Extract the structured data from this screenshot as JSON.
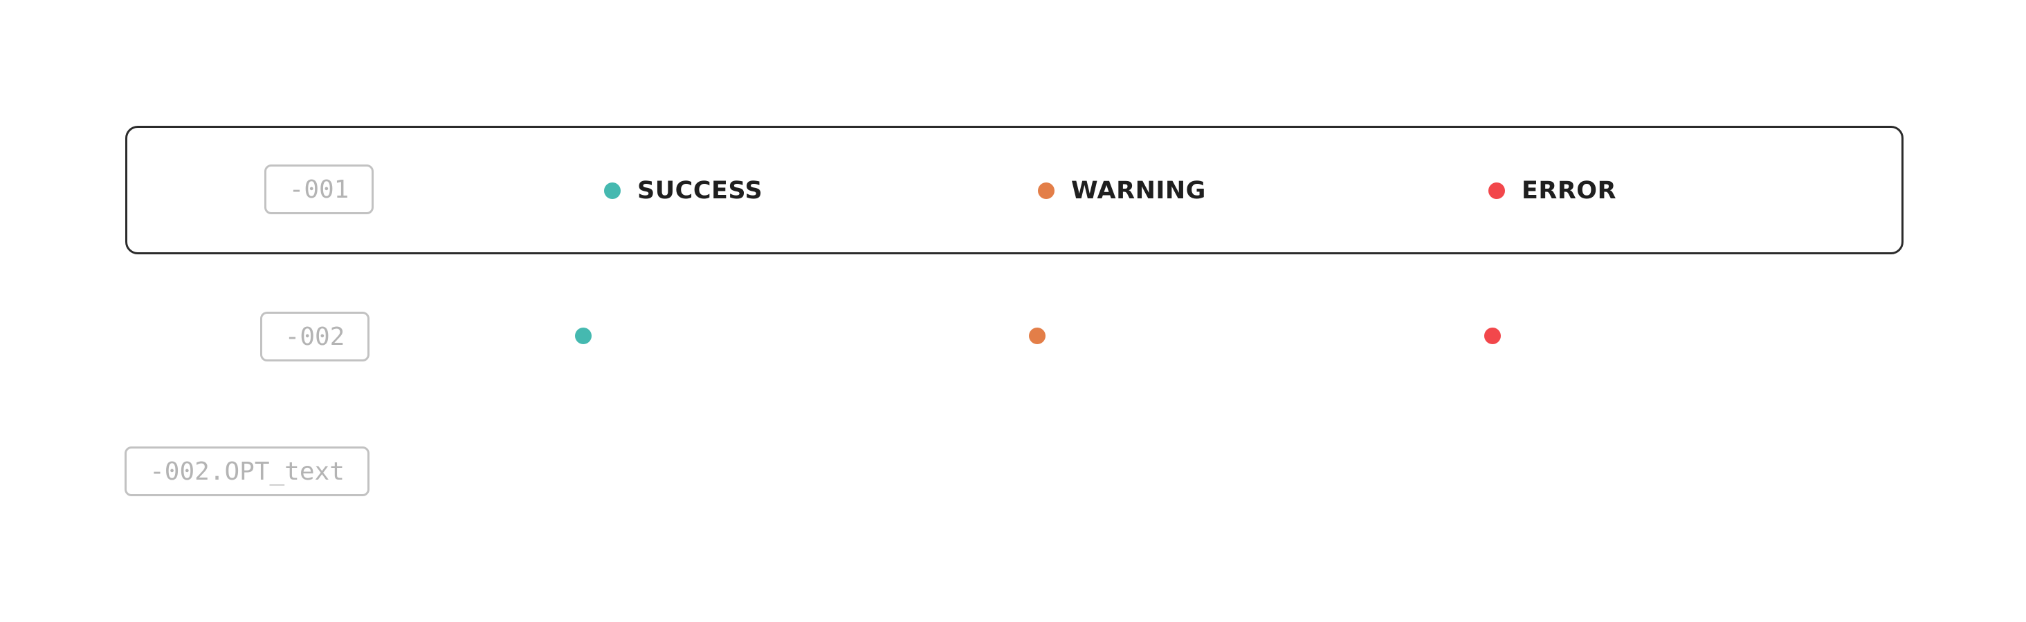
{
  "rows": {
    "row_001": {
      "tag": "-001",
      "items": [
        {
          "label": "SUCCESS",
          "color": "#45b9b0"
        },
        {
          "label": "WARNING",
          "color": "#e37e48"
        },
        {
          "label": "ERROR",
          "color": "#f2474b"
        }
      ]
    },
    "row_002": {
      "tag": "-002",
      "dots": [
        {
          "color": "#45b9b0"
        },
        {
          "color": "#e37e48"
        },
        {
          "color": "#f2474b"
        }
      ]
    },
    "row_opt": {
      "tag": "-002.OPT_text"
    }
  }
}
